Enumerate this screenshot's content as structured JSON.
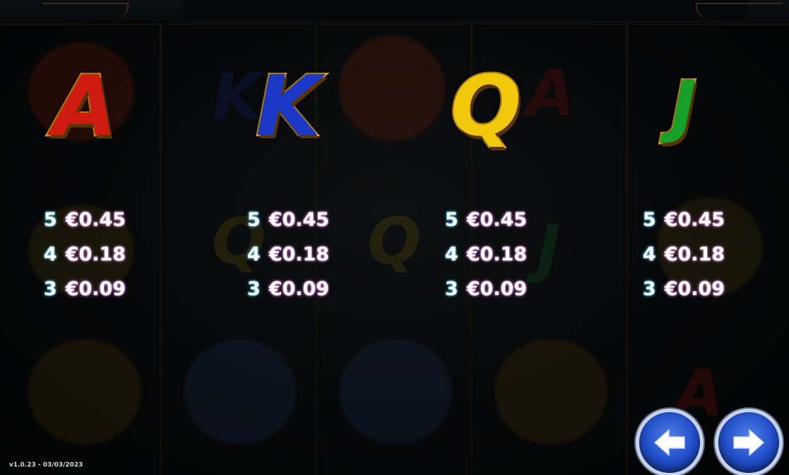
{
  "paytable": {
    "symbols": [
      {
        "icon": "letter-a-symbol-icon",
        "glyph": "A",
        "fill": "#d01b10",
        "pays": [
          {
            "count": "5",
            "amount": "€0.45"
          },
          {
            "count": "4",
            "amount": "€0.18"
          },
          {
            "count": "3",
            "amount": "€0.09"
          }
        ]
      },
      {
        "icon": "letter-k-symbol-icon",
        "glyph": "K",
        "fill": "#1b38c8",
        "pays": [
          {
            "count": "5",
            "amount": "€0.45"
          },
          {
            "count": "4",
            "amount": "€0.18"
          },
          {
            "count": "3",
            "amount": "€0.09"
          }
        ]
      },
      {
        "icon": "letter-q-symbol-icon",
        "glyph": "Q",
        "fill": "#f2c80a",
        "pays": [
          {
            "count": "5",
            "amount": "€0.45"
          },
          {
            "count": "4",
            "amount": "€0.18"
          },
          {
            "count": "3",
            "amount": "€0.09"
          }
        ]
      },
      {
        "icon": "letter-j-symbol-icon",
        "glyph": "J",
        "fill": "#16a02a",
        "pays": [
          {
            "count": "5",
            "amount": "€0.45"
          },
          {
            "count": "4",
            "amount": "€0.18"
          },
          {
            "count": "3",
            "amount": "€0.09"
          }
        ]
      }
    ]
  },
  "navigation": {
    "prev_icon": "arrow-left-icon",
    "next_icon": "arrow-right-icon"
  },
  "footer": {
    "version": "v1.0.23 - 03/03/2023"
  },
  "colors": {
    "accent_gold": "#f0b31e",
    "button_blue": "#1f4cc6",
    "count_glow": "#4fd4ff",
    "amount_glow": "#ff9bf0"
  }
}
